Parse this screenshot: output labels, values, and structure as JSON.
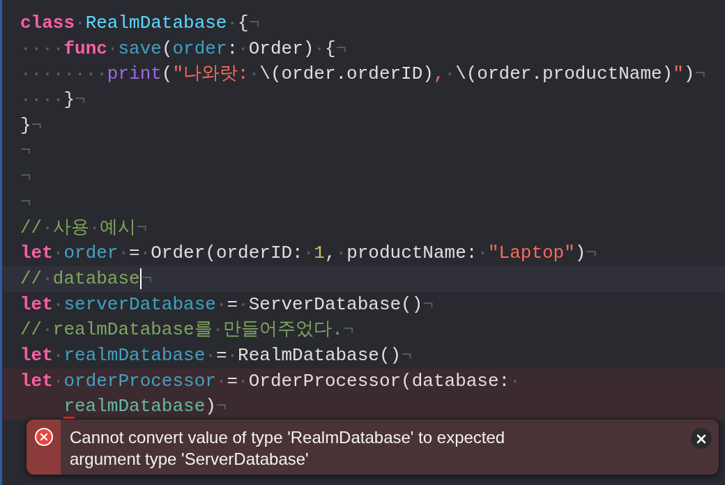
{
  "editor": {
    "lines": [
      {
        "tokens": [
          {
            "kind": "keyword",
            "text": "class"
          },
          {
            "kind": "space",
            "text": "·"
          },
          {
            "kind": "typedecl",
            "text": "RealmDatabase"
          },
          {
            "kind": "space",
            "text": "·"
          },
          {
            "kind": "plain",
            "text": "{"
          },
          {
            "kind": "eol",
            "text": "¬"
          }
        ]
      },
      {
        "tokens": [
          {
            "kind": "space",
            "text": "····"
          },
          {
            "kind": "keyword",
            "text": "func"
          },
          {
            "kind": "space",
            "text": "·"
          },
          {
            "kind": "decl",
            "text": "save"
          },
          {
            "kind": "plain",
            "text": "("
          },
          {
            "kind": "decl",
            "text": "order"
          },
          {
            "kind": "plain",
            "text": ":"
          },
          {
            "kind": "space",
            "text": "·"
          },
          {
            "kind": "plain",
            "text": "Order)"
          },
          {
            "kind": "space",
            "text": "·"
          },
          {
            "kind": "plain",
            "text": "{"
          },
          {
            "kind": "eol",
            "text": "¬"
          }
        ]
      },
      {
        "tokens": [
          {
            "kind": "space",
            "text": "········"
          },
          {
            "kind": "call",
            "text": "print"
          },
          {
            "kind": "plain",
            "text": "("
          },
          {
            "kind": "string",
            "text": "\"나와랏:"
          },
          {
            "kind": "space",
            "text": "·"
          },
          {
            "kind": "plain",
            "text": "\\(order.orderID)"
          },
          {
            "kind": "string",
            "text": ","
          },
          {
            "kind": "space",
            "text": "·"
          },
          {
            "kind": "plain",
            "text": "\\(order.productName)"
          },
          {
            "kind": "string",
            "text": "\""
          },
          {
            "kind": "plain",
            "text": ")"
          },
          {
            "kind": "eol",
            "text": "¬"
          }
        ]
      },
      {
        "tokens": [
          {
            "kind": "space",
            "text": "····"
          },
          {
            "kind": "plain",
            "text": "}"
          },
          {
            "kind": "eol",
            "text": "¬"
          }
        ]
      },
      {
        "tokens": [
          {
            "kind": "plain",
            "text": "}"
          },
          {
            "kind": "eol",
            "text": "¬"
          }
        ]
      },
      {
        "tokens": [
          {
            "kind": "eol",
            "text": "¬"
          }
        ]
      },
      {
        "tokens": [
          {
            "kind": "eol",
            "text": "¬"
          }
        ]
      },
      {
        "tokens": [
          {
            "kind": "eol",
            "text": "¬"
          }
        ]
      },
      {
        "tokens": [
          {
            "kind": "comment",
            "text": "//"
          },
          {
            "kind": "space",
            "text": "·"
          },
          {
            "kind": "comment",
            "text": "사용"
          },
          {
            "kind": "space",
            "text": "·"
          },
          {
            "kind": "comment",
            "text": "예시"
          },
          {
            "kind": "eol",
            "text": "¬"
          }
        ]
      },
      {
        "tokens": [
          {
            "kind": "keyword",
            "text": "let"
          },
          {
            "kind": "space",
            "text": "·"
          },
          {
            "kind": "decl",
            "text": "order"
          },
          {
            "kind": "space",
            "text": "·"
          },
          {
            "kind": "plain",
            "text": "="
          },
          {
            "kind": "space",
            "text": "·"
          },
          {
            "kind": "plain",
            "text": "Order(orderID:"
          },
          {
            "kind": "space",
            "text": "·"
          },
          {
            "kind": "number",
            "text": "1"
          },
          {
            "kind": "plain",
            "text": ","
          },
          {
            "kind": "space",
            "text": "·"
          },
          {
            "kind": "plain",
            "text": "productName:"
          },
          {
            "kind": "space",
            "text": "·"
          },
          {
            "kind": "string",
            "text": "\"Laptop\""
          },
          {
            "kind": "plain",
            "text": ")"
          },
          {
            "kind": "eol",
            "text": "¬"
          }
        ]
      },
      {
        "current": true,
        "caret": true,
        "tokens": [
          {
            "kind": "comment",
            "text": "//"
          },
          {
            "kind": "space",
            "text": "·"
          },
          {
            "kind": "comment",
            "text": "database"
          },
          {
            "kind": "eol",
            "text": "¬"
          }
        ]
      },
      {
        "tokens": [
          {
            "kind": "keyword",
            "text": "let"
          },
          {
            "kind": "space",
            "text": "·"
          },
          {
            "kind": "decl",
            "text": "serverDatabase"
          },
          {
            "kind": "space",
            "text": "·"
          },
          {
            "kind": "plain",
            "text": "="
          },
          {
            "kind": "space",
            "text": "·"
          },
          {
            "kind": "plain",
            "text": "ServerDatabase()"
          },
          {
            "kind": "eol",
            "text": "¬"
          }
        ]
      },
      {
        "tokens": [
          {
            "kind": "comment",
            "text": "//"
          },
          {
            "kind": "space",
            "text": "·"
          },
          {
            "kind": "comment",
            "text": "realmDatabase를"
          },
          {
            "kind": "space",
            "text": "·"
          },
          {
            "kind": "comment",
            "text": "만들어주었다."
          },
          {
            "kind": "eol",
            "text": "¬"
          }
        ]
      },
      {
        "tokens": [
          {
            "kind": "keyword",
            "text": "let"
          },
          {
            "kind": "space",
            "text": "·"
          },
          {
            "kind": "decl",
            "text": "realmDatabase"
          },
          {
            "kind": "space",
            "text": "·"
          },
          {
            "kind": "plain",
            "text": "="
          },
          {
            "kind": "space",
            "text": "·"
          },
          {
            "kind": "plain",
            "text": "RealmDatabase()"
          },
          {
            "kind": "eol",
            "text": "¬"
          }
        ]
      },
      {
        "error": true,
        "tokens": [
          {
            "kind": "keyword",
            "text": "let"
          },
          {
            "kind": "space",
            "text": "·"
          },
          {
            "kind": "decl",
            "text": "orderProcessor"
          },
          {
            "kind": "space",
            "text": "·"
          },
          {
            "kind": "plain",
            "text": "="
          },
          {
            "kind": "space",
            "text": "·"
          },
          {
            "kind": "plain",
            "text": "OrderProcessor(database:"
          },
          {
            "kind": "space",
            "text": "·"
          }
        ],
        "continuation": [
          {
            "kind": "ref",
            "text": "r",
            "flagged": true
          },
          {
            "kind": "ref",
            "text": "ealmDatabase"
          },
          {
            "kind": "plain",
            "text": ")"
          },
          {
            "kind": "eol",
            "text": "¬"
          }
        ]
      }
    ]
  },
  "issue": {
    "kind": "error",
    "message": "Cannot convert value of type 'RealmDatabase' to expected argument type 'ServerDatabase'",
    "closable": true
  }
}
